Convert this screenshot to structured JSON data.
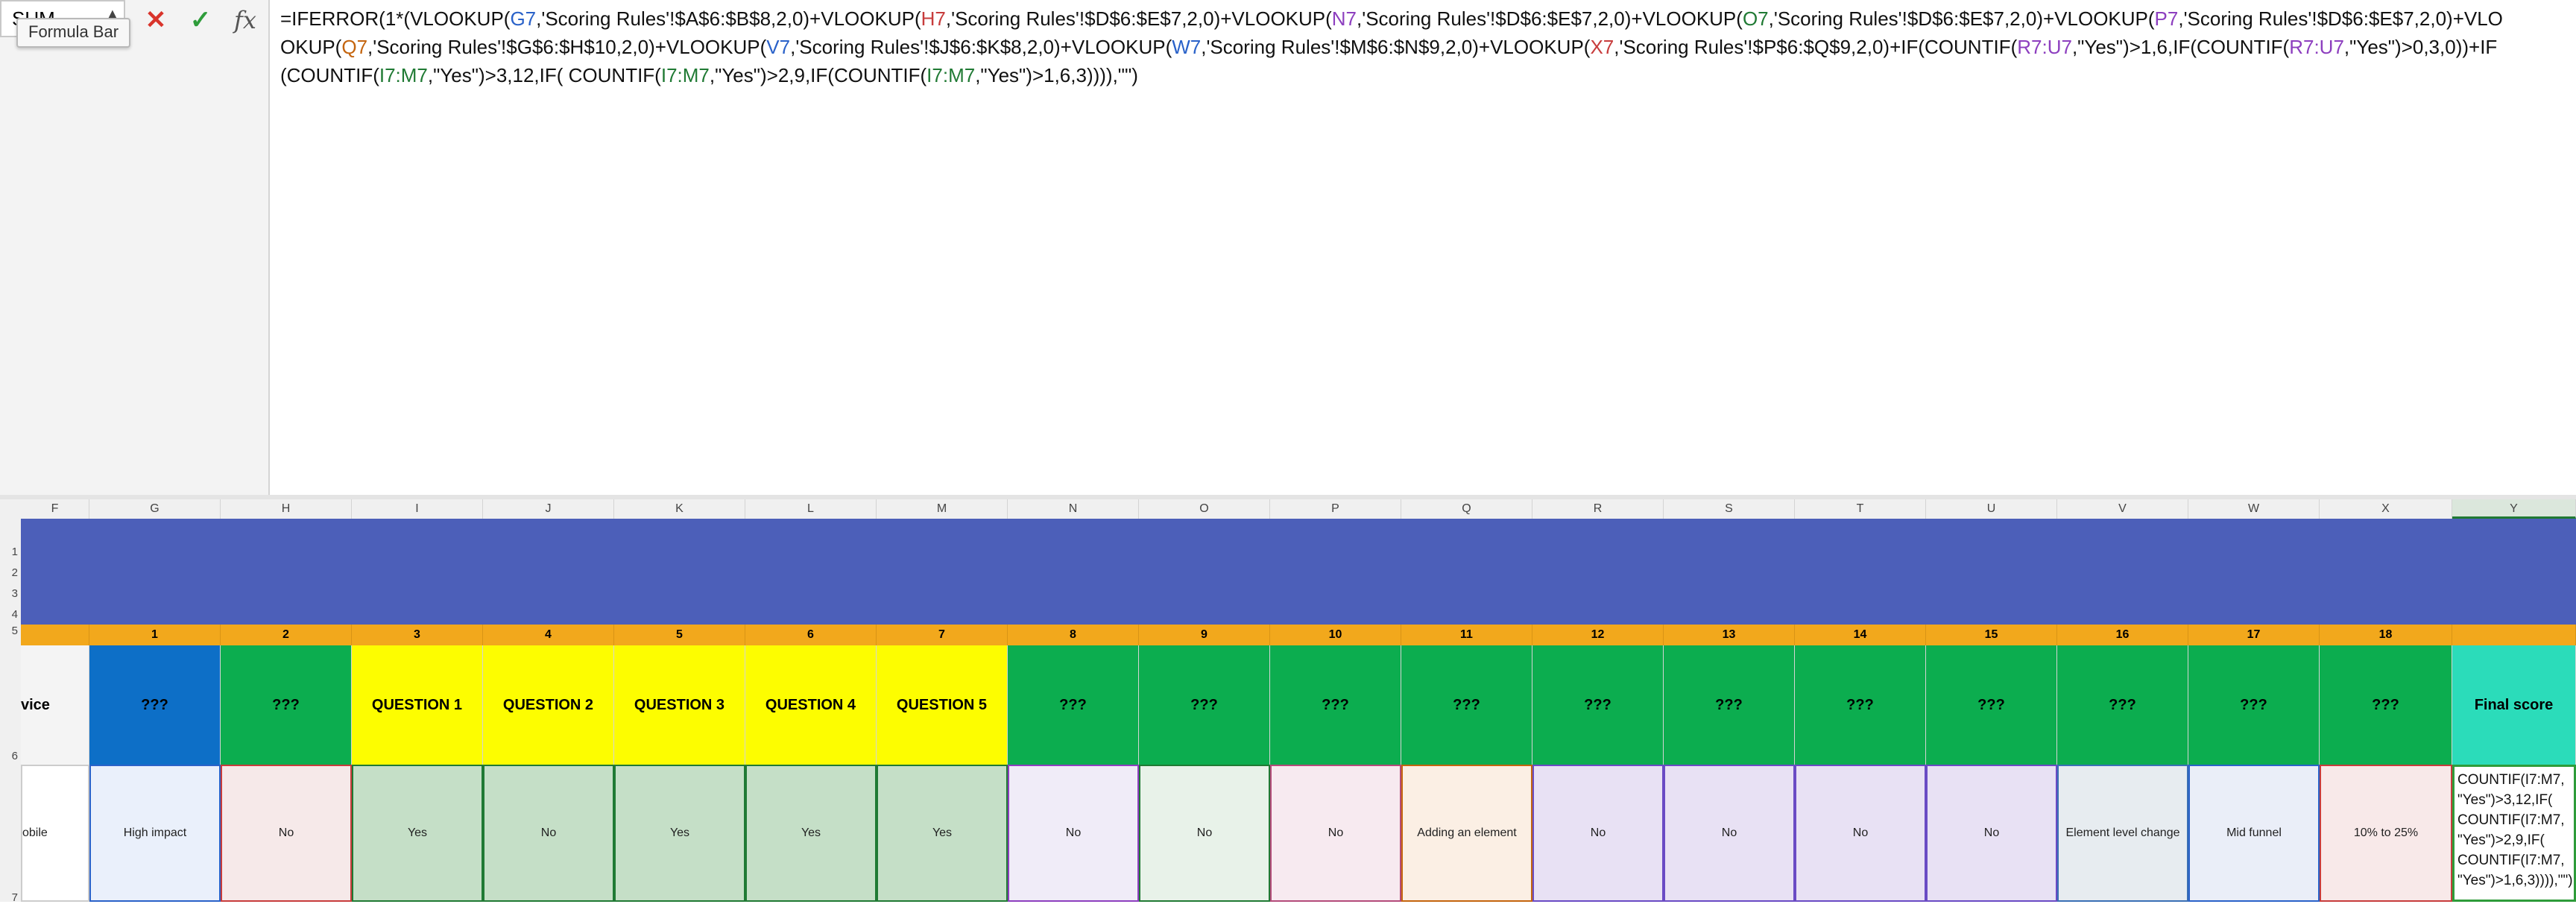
{
  "name_box": {
    "value": "SUM"
  },
  "tooltip": "Formula Bar",
  "formula_bar": {
    "cancel_label": "✕",
    "enter_label": "✓",
    "fx_label": "fx",
    "formula": [
      {
        "t": "=IFERROR(1*(VLOOKUP(",
        "c": ""
      },
      {
        "t": "G7",
        "c": "c-blue"
      },
      {
        "t": ",'Scoring Rules'!$A$6:$B$8,2,0)+VLOOKUP(",
        "c": ""
      },
      {
        "t": "H7",
        "c": "c-red"
      },
      {
        "t": ",'Scoring Rules'!$D$6:$E$7,2,0)+VLOOKUP(",
        "c": ""
      },
      {
        "t": "N7",
        "c": "c-purple"
      },
      {
        "t": ",'Scoring Rules'!$D$6:$E$7,2,0)+VLOOKUP(",
        "c": ""
      },
      {
        "t": "O7",
        "c": "c-green"
      },
      {
        "t": ",'Scoring Rules'!$D$6:$E$7,2,0)+VLOOKUP(",
        "c": ""
      },
      {
        "t": "P7",
        "c": "c-purple"
      },
      {
        "t": ",'Scoring Rules'!$D$6:$E$7,2,0)+VLOOKUP(",
        "c": ""
      },
      {
        "t": "Q7",
        "c": "c-orange"
      },
      {
        "t": ",'Scoring Rules'!$G$6:$H$10,2,0)+VLOOKUP(",
        "c": ""
      },
      {
        "t": "V7",
        "c": "c-blue"
      },
      {
        "t": ",'Scoring Rules'!$J$6:$K$8,2,0)+VLOOKUP(",
        "c": ""
      },
      {
        "t": "W7",
        "c": "c-blue"
      },
      {
        "t": ",'Scoring Rules'!$M$6:$N$9,2,0)+VLOOKUP(",
        "c": ""
      },
      {
        "t": "X7",
        "c": "c-red"
      },
      {
        "t": ",'Scoring Rules'!$P$6:$Q$9,2,0)+IF(COUNTIF(",
        "c": ""
      },
      {
        "t": "R7:U7",
        "c": "c-purple"
      },
      {
        "t": ",\"Yes\")>1,6,IF(COUNTIF(",
        "c": ""
      },
      {
        "t": "R7:U7",
        "c": "c-purple"
      },
      {
        "t": ",\"Yes\")>0,3,0))+IF(COUNTIF(",
        "c": ""
      },
      {
        "t": "I7:M7",
        "c": "c-green"
      },
      {
        "t": ",\"Yes\")>3,12,IF( COUNTIF(",
        "c": ""
      },
      {
        "t": "I7:M7",
        "c": "c-green"
      },
      {
        "t": ",\"Yes\")>2,9,IF(COUNTIF(",
        "c": ""
      },
      {
        "t": "I7:M7",
        "c": "c-green"
      },
      {
        "t": ",\"Yes\")>1,6,3)))),\"\")",
        "c": ""
      }
    ]
  },
  "columns": [
    "F",
    "G",
    "H",
    "I",
    "J",
    "K",
    "L",
    "M",
    "N",
    "O",
    "P",
    "Q",
    "R",
    "S",
    "T",
    "U",
    "V",
    "W",
    "X",
    "Y"
  ],
  "rows": [
    "1",
    "2",
    "3",
    "4",
    "5",
    "6",
    "7"
  ],
  "row5_numbers": [
    "",
    "1",
    "2",
    "3",
    "4",
    "5",
    "6",
    "7",
    "8",
    "9",
    "10",
    "11",
    "12",
    "13",
    "14",
    "15",
    "16",
    "17",
    "18",
    ""
  ],
  "row6_headers": [
    "vice",
    "???",
    "???",
    "QUESTION 1",
    "QUESTION 2",
    "QUESTION 3",
    "QUESTION 4",
    "QUESTION 5",
    "???",
    "???",
    "???",
    "???",
    "???",
    "???",
    "???",
    "???",
    "???",
    "???",
    "???",
    "Final score"
  ],
  "row7_values": [
    "obile",
    "High impact",
    "No",
    "Yes",
    "No",
    "Yes",
    "Yes",
    "Yes",
    "No",
    "No",
    "No",
    "Adding an element",
    "No",
    "No",
    "No",
    "No",
    "Element level change",
    "Mid funnel",
    "10% to 25%",
    "COUNTIF(I7:M7, \"Yes\")>3,12,IF( COUNTIF(I7:M7, \"Yes\")>2,9,IF( COUNTIF(I7:M7, \"Yes\")>1,6,3)))),\"\")"
  ],
  "colors": {
    "banner": "#4c5fb9",
    "row5_orange": "#f2a81c",
    "header_blue": "#0d6fc7",
    "header_green": "#0cad4f",
    "header_yellow": "#fdfd00",
    "header_teal": "#2bdcba"
  }
}
